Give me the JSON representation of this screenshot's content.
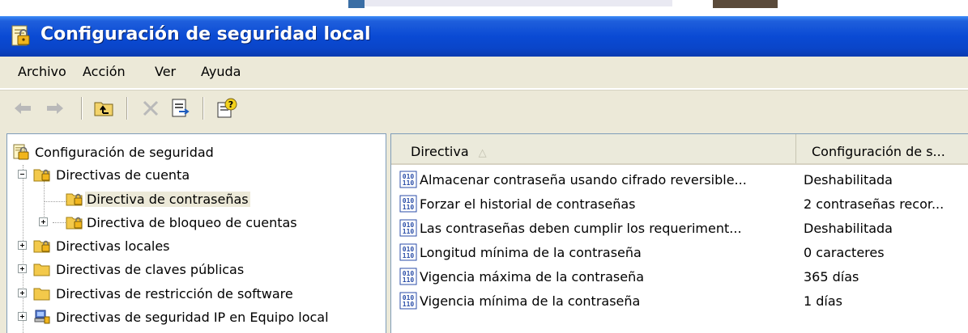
{
  "window": {
    "title": "Configuración de seguridad local"
  },
  "menu": [
    "Archivo",
    "Acción",
    "Ver",
    "Ayuda"
  ],
  "toolbar": {
    "buttons": [
      {
        "icon": "back-arrow-icon",
        "enabled": false
      },
      {
        "icon": "forward-arrow-icon",
        "enabled": false
      },
      {
        "icon": "up-one-level-icon",
        "enabled": true
      },
      {
        "icon": "delete-icon",
        "enabled": false
      },
      {
        "icon": "export-list-icon",
        "enabled": true
      },
      {
        "icon": "help-icon",
        "enabled": true
      }
    ]
  },
  "tree": {
    "items": [
      {
        "label": "Configuración de seguridad",
        "icon": "security-settings-icon"
      },
      {
        "label": "Directivas de cuenta",
        "icon": "folder-lock-icon",
        "expanded": true
      },
      {
        "label": "Directiva de contraseñas",
        "icon": "folder-lock-icon",
        "selected": true
      },
      {
        "label": "Directiva de bloqueo de cuentas",
        "icon": "folder-lock-icon"
      },
      {
        "label": "Directivas locales",
        "icon": "folder-lock-icon"
      },
      {
        "label": "Directivas de claves públicas",
        "icon": "folder-icon"
      },
      {
        "label": "Directivas de restricción de software",
        "icon": "folder-icon"
      },
      {
        "label": "Directivas de seguridad IP en Equipo local",
        "icon": "ip-security-icon"
      }
    ]
  },
  "list": {
    "columns": [
      "Directiva",
      "Configuración de s..."
    ],
    "rows": [
      {
        "name": "Almacenar contraseña usando cifrado reversible...",
        "value": "Deshabilitada"
      },
      {
        "name": "Forzar el historial de contraseñas",
        "value": "2 contraseñas recor..."
      },
      {
        "name": "Las contraseñas deben cumplir los requeriment...",
        "value": "Deshabilitada"
      },
      {
        "name": "Longitud mínima de la contraseña",
        "value": "0 caracteres"
      },
      {
        "name": "Vigencia máxima de la contraseña",
        "value": "365 días"
      },
      {
        "name": "Vigencia mínima de la contraseña",
        "value": "1 días"
      }
    ]
  },
  "colors": {
    "titlebar": "#0a4ad4",
    "chrome": "#ece9d8",
    "folder": "#f3c94b",
    "selection": "#ece9d8"
  }
}
